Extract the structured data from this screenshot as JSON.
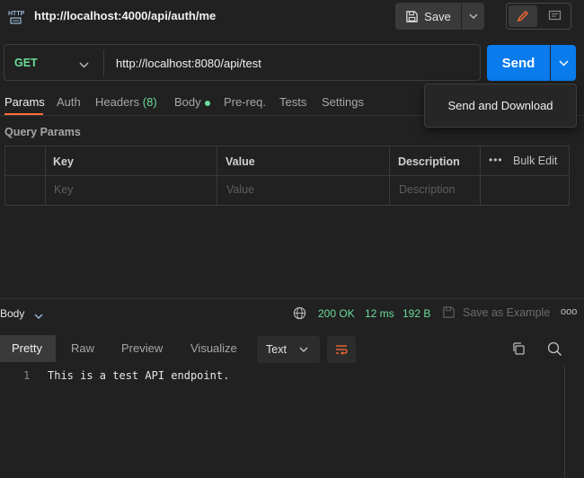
{
  "header": {
    "request_name": "http://localhost:4000/api/auth/me",
    "http_icon_label": "HTTP",
    "save_label": "Save"
  },
  "request": {
    "method": "GET",
    "url": "http://localhost:8080/api/test",
    "send_label": "Send"
  },
  "send_menu": {
    "items": [
      "Send and Download"
    ]
  },
  "tabs": {
    "params": "Params",
    "auth": "Auth",
    "headers": "Headers",
    "headers_count": "(8)",
    "body": "Body",
    "prereq": "Pre-req.",
    "tests": "Tests",
    "settings": "Settings",
    "active": "Params"
  },
  "query_params": {
    "title": "Query Params",
    "columns": [
      "Key",
      "Value",
      "Description"
    ],
    "placeholders": [
      "Key",
      "Value",
      "Description"
    ],
    "bulk_edit_label": "Bulk Edit",
    "more_label": "•••"
  },
  "response": {
    "body_label": "Body",
    "status": "200 OK",
    "time": "12 ms",
    "size": "192 B",
    "save_example_label": "Save as Example",
    "more_label": "ooo",
    "view_tabs": [
      "Pretty",
      "Raw",
      "Preview",
      "Visualize"
    ],
    "active_view": "Pretty",
    "format": "Text",
    "lines": [
      {
        "number": "1",
        "text": "This is a test API endpoint."
      }
    ]
  },
  "colors": {
    "accent": "#097bed",
    "success": "#6bdd9a",
    "tab_underline": "#ff6c37"
  }
}
